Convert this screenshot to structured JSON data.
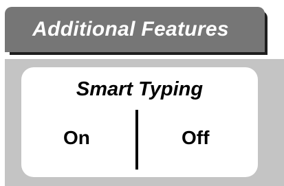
{
  "header": {
    "title": "Additional Features"
  },
  "setting": {
    "title": "Smart Typing",
    "options": {
      "on": "On",
      "off": "Off"
    }
  },
  "colors": {
    "header_bg": "#767676",
    "header_shadow": "#1e1e1e",
    "panel_bg": "#c4c4c4",
    "card_bg": "#ffffff"
  }
}
